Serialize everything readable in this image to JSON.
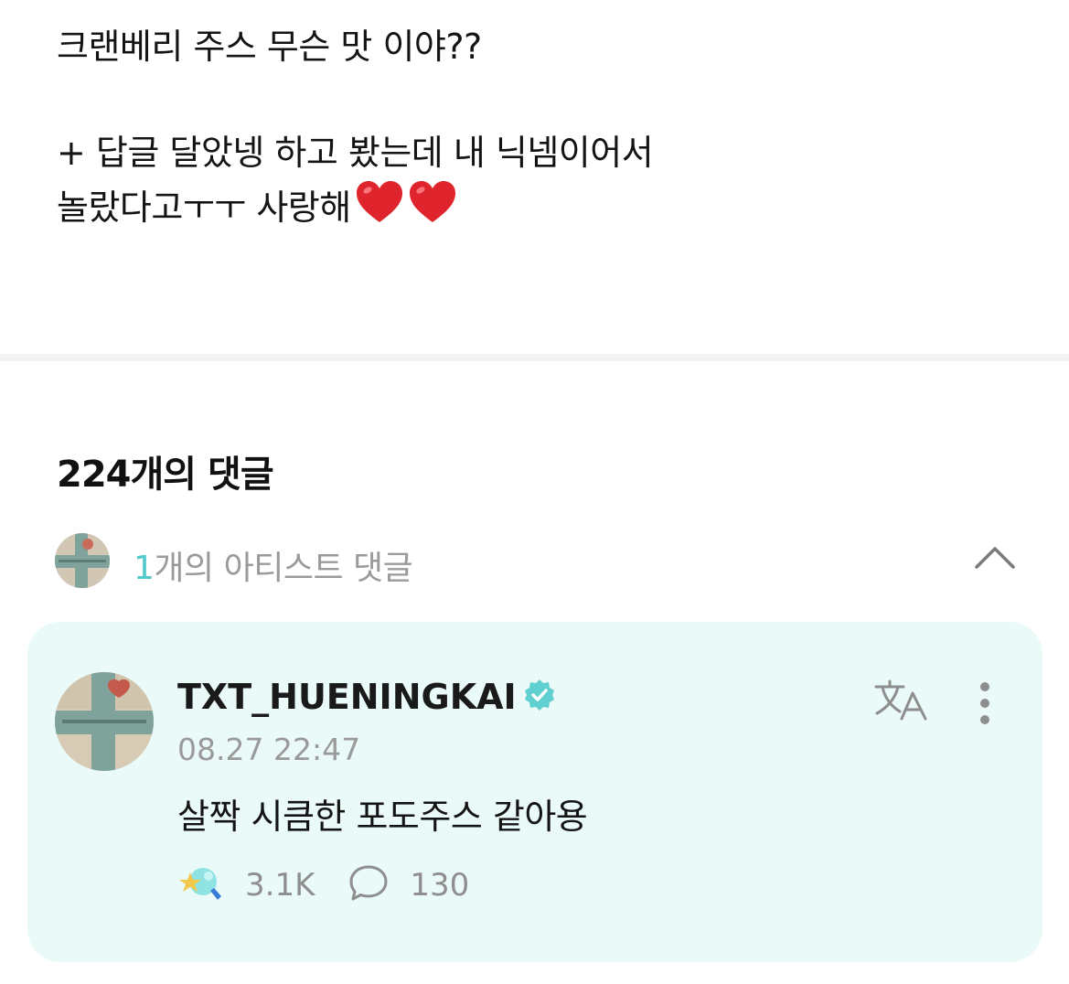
{
  "post": {
    "line1": "크랜베리 주스 무슨 맛 이야??",
    "line2": "+ 답글 달았넹 하고 봤는데 내 닉넴이어서",
    "line3": "놀랐다고ㅜㅜ 사랑해"
  },
  "comments_header": {
    "count_label": "224개의 댓글"
  },
  "artist_comments": {
    "count": "1",
    "label": "개의 아티스트 댓글"
  },
  "comment": {
    "username": "TXT_HUENINGKAI",
    "timestamp": "08.27 22:47",
    "text": "살짝 시큼한 포도주스 같아용",
    "likes": "3.1K",
    "replies": "130"
  },
  "icons": {
    "heart": "red-heart-emoji",
    "verified": "verified-badge-icon",
    "chevron": "chevron-up-icon",
    "translate": "translate-icon",
    "more": "more-vertical-icon",
    "like": "weverse-like-icon",
    "reply": "comment-bubble-icon"
  },
  "colors": {
    "accent": "#4fc9c9",
    "card_background": "#e9faf8",
    "muted_text": "#9a9a9a",
    "heart": "#e0242d"
  }
}
